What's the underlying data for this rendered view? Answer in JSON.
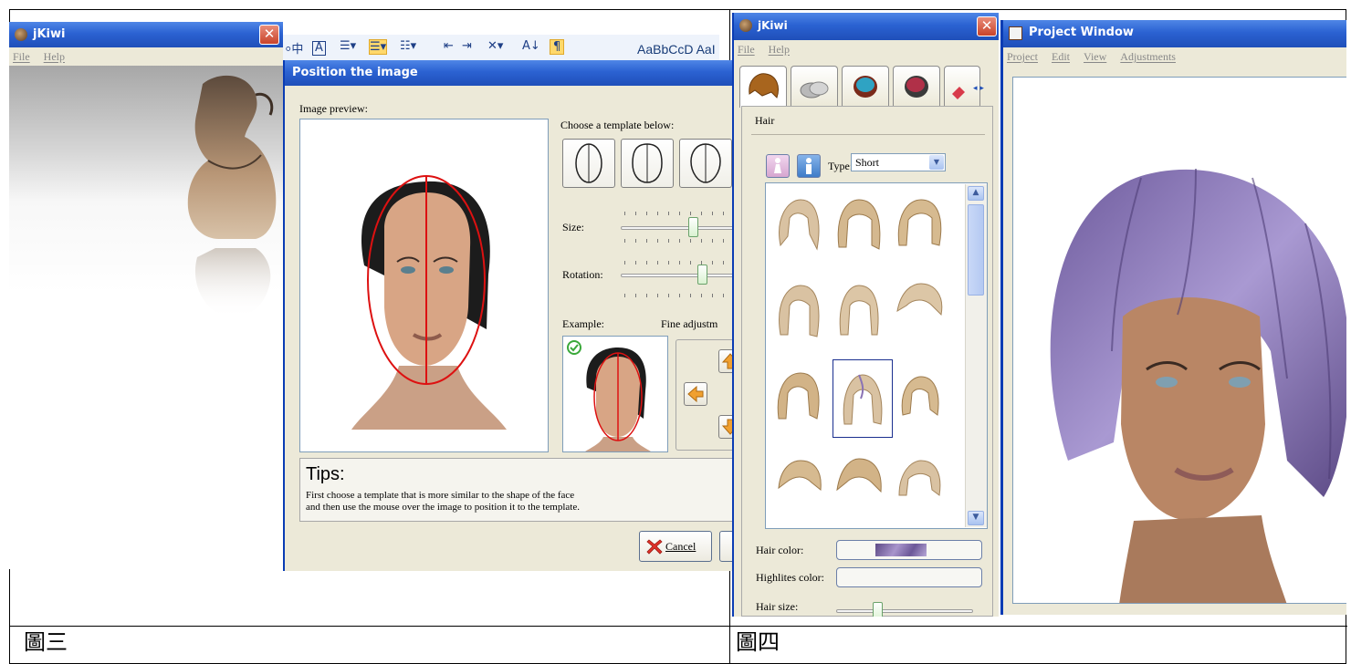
{
  "document": {
    "caption_left": "圖三",
    "caption_right": "圖四"
  },
  "left_window": {
    "title": "jKiwi",
    "close_glyph": "✕",
    "menu": [
      "File",
      "Help"
    ]
  },
  "word_toolbar": {
    "style_sample": "AaBbCcD  AaI"
  },
  "position_dialog": {
    "title": "Position the image",
    "image_preview_label": "Image preview:",
    "choose_template_label": "Choose a template below:",
    "size_label": "Size:",
    "rotation_label": "Rotation:",
    "example_label": "Example:",
    "fine_adjust_label": "Fine adjustm",
    "tips_title": "Tips:",
    "tips_line1": "First choose a template that is more similar to the shape of the face",
    "tips_line2": "and then use the mouse over the image to position it to the template.",
    "cancel_label": "Cancel"
  },
  "right_window": {
    "title": "jKiwi",
    "close_glyph": "✕",
    "menu": [
      "File",
      "Help"
    ],
    "section_title": "Hair",
    "type_label": "Type:",
    "type_value": "Short",
    "hair_color_label": "Hair color:",
    "highlights_color_label": "Highlites color:",
    "hair_size_label": "Hair size:",
    "accent": "#8a73b5"
  },
  "project_window": {
    "title": "Project Window",
    "menu": [
      "Project",
      "Edit",
      "View",
      "Adjustments"
    ]
  }
}
